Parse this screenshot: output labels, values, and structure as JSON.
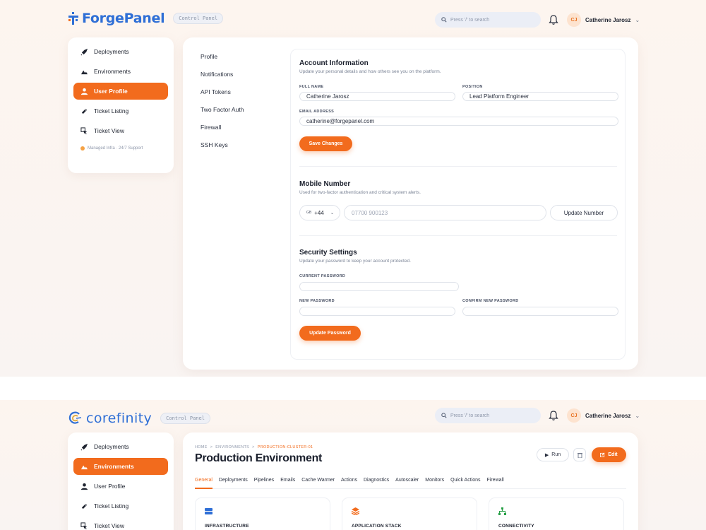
{
  "screen_a": {
    "brand": {
      "name": "ForgePanel",
      "badge": "Control Panel"
    },
    "search": {
      "placeholder": "Press '/' to search"
    },
    "user": {
      "initials": "CJ",
      "name": "Catherine Jarosz"
    },
    "sidebar": {
      "items": [
        {
          "label": "Deployments",
          "icon": "rocket-icon",
          "active": false
        },
        {
          "label": "Environments",
          "icon": "terrain-icon",
          "active": false
        },
        {
          "label": "User Profile",
          "icon": "user-icon",
          "active": true
        },
        {
          "label": "Ticket Listing",
          "icon": "tag-icon",
          "active": false
        },
        {
          "label": "Ticket View",
          "icon": "cursor-icon",
          "active": false
        }
      ],
      "footer": "Managed Infra · 24/7 Support"
    },
    "subnav": [
      "Profile",
      "Notifications",
      "API Tokens",
      "Two Factor Auth",
      "Firewall",
      "SSH Keys"
    ],
    "account": {
      "title": "Account Information",
      "desc": "Update your personal details and how others see you on the platform.",
      "full_name_label": "FULL NAME",
      "full_name": "Catherine Jarosz",
      "position_label": "POSITION",
      "position": "Lead Platform Engineer",
      "email_label": "EMAIL ADDRESS",
      "email": "catherine@forgepanel.com",
      "save_label": "Save Changes"
    },
    "mobile": {
      "title": "Mobile Number",
      "desc": "Used for two-factor authentication and critical system alerts.",
      "country_flag": "GB",
      "country_code": "+44",
      "placeholder": "07700 900123",
      "update_label": "Update Number"
    },
    "security": {
      "title": "Security Settings",
      "desc": "Update your password to keep your account protected.",
      "current_label": "CURRENT PASSWORD",
      "new_label": "NEW PASSWORD",
      "confirm_label": "CONFIRM NEW PASSWORD",
      "update_label": "Update Password"
    }
  },
  "screen_b": {
    "brand": {
      "name": "corefinity",
      "badge": "Control Panel"
    },
    "search": {
      "placeholder": "Press '/' to search"
    },
    "user": {
      "initials": "CJ",
      "name": "Catherine Jarosz"
    },
    "sidebar": {
      "items": [
        {
          "label": "Deployments",
          "icon": "rocket-icon",
          "active": false
        },
        {
          "label": "Environments",
          "icon": "terrain-icon",
          "active": true
        },
        {
          "label": "User Profile",
          "icon": "user-icon",
          "active": false
        },
        {
          "label": "Ticket Listing",
          "icon": "tag-icon",
          "active": false
        },
        {
          "label": "Ticket View",
          "icon": "cursor-icon",
          "active": false
        }
      ]
    },
    "breadcrumb": {
      "home": "HOME",
      "section": "ENVIRONMENTS",
      "current": "PRODUCTION-CLUSTER-01",
      "separator": ">"
    },
    "title": "Production Environment",
    "actions": {
      "run": "Run",
      "edit": "Edit"
    },
    "tabs": [
      "General",
      "Deployments",
      "Pipelines",
      "Emails",
      "Cache Warmer",
      "Actions",
      "Diagnostics",
      "Autoscaler",
      "Monitors",
      "Quick Actions",
      "Firewall"
    ],
    "active_tab": "General",
    "cards": [
      {
        "title": "INFRASTRUCTURE",
        "icon": "server-icon",
        "color": "#2f6fd6"
      },
      {
        "title": "APPLICATION STACK",
        "icon": "layers-icon",
        "color": "#f26b1d"
      },
      {
        "title": "CONNECTIVITY",
        "icon": "network-icon",
        "color": "#27a046"
      }
    ]
  },
  "colors": {
    "accent": "#f26b1d",
    "brand": "#2f6fd6",
    "background": "#fdf5ef"
  }
}
